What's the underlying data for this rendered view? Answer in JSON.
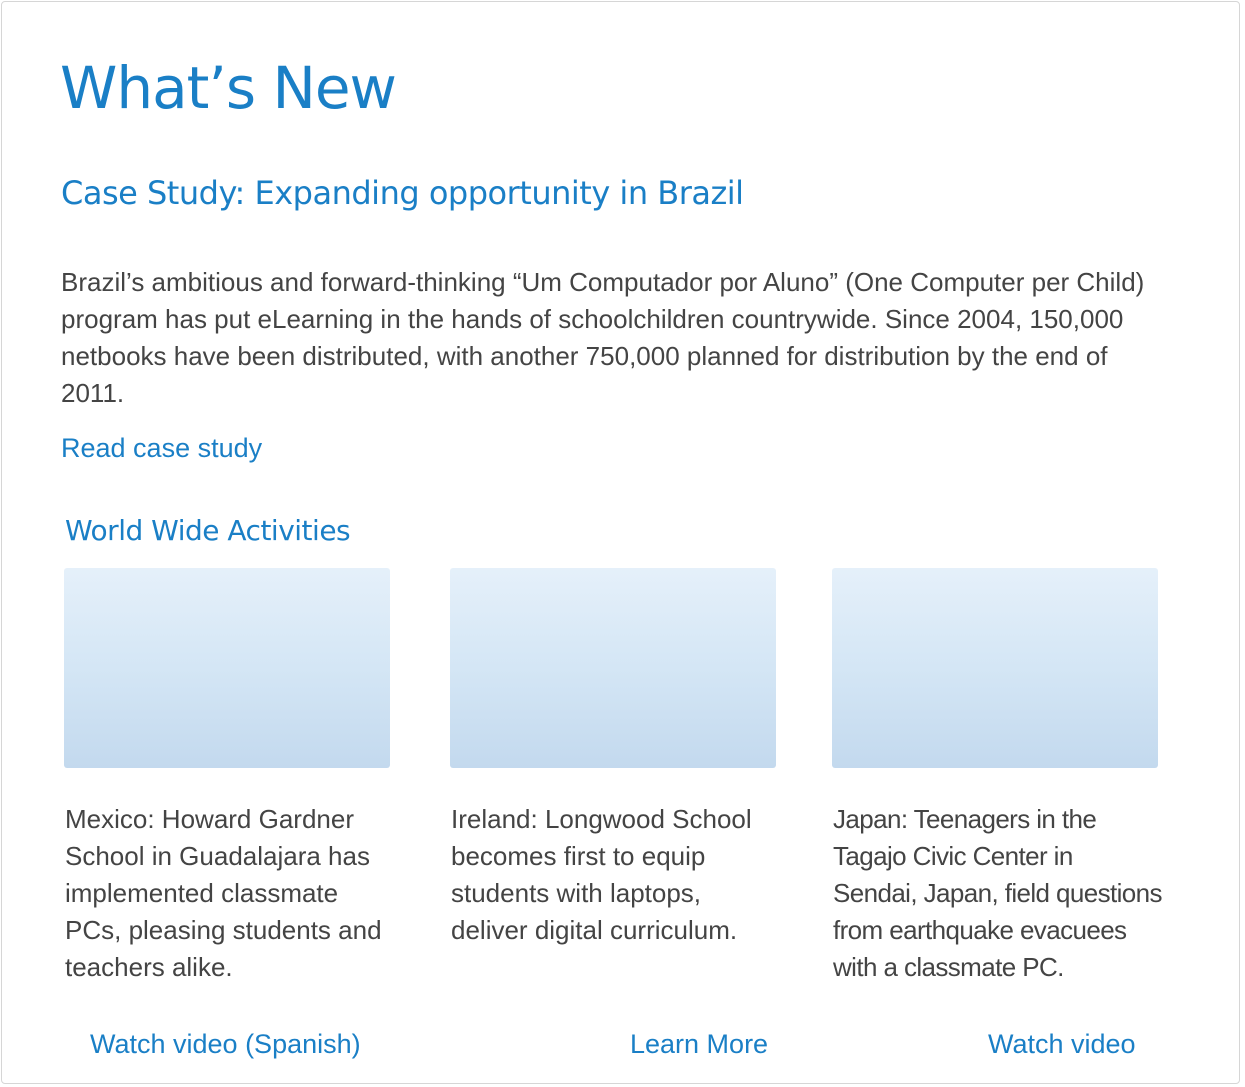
{
  "header": {
    "title": "What’s New"
  },
  "case_study": {
    "title": "Case Study: Expanding opportunity in Brazil",
    "body": "Brazil’s ambitious and forward-thinking “Um Computador por Aluno” (One Computer per Child) program has put eLearning in the hands of schoolchildren countrywide. Since 2004, 150,000 netbooks have been distributed, with another 750,000 planned for distribution by the end of 2011.",
    "link_label": "Read case study"
  },
  "activities": {
    "title": "World Wide Activities",
    "items": [
      {
        "text": "Mexico: Howard Gardner School in Guadalajara has implemented classmate PCs, pleasing students and teachers alike.",
        "link_label": "Watch video (Spanish)"
      },
      {
        "text": "Ireland: Longwood School becomes first to equip students with laptops, deliver digital curriculum.",
        "link_label": "Learn More"
      },
      {
        "text": "Japan: Teenagers in the Tagajo Civic Center in Sendai, Japan, field questions from earthquake evacuees with a classmate PC.",
        "link_label": "Watch video"
      }
    ]
  },
  "colors": {
    "accent": "#1a7fc6",
    "body_text": "#444444",
    "border": "#d6d6d6",
    "thumbnail_top": "#e5f0fa",
    "thumbnail_bottom": "#c3d9ee"
  }
}
